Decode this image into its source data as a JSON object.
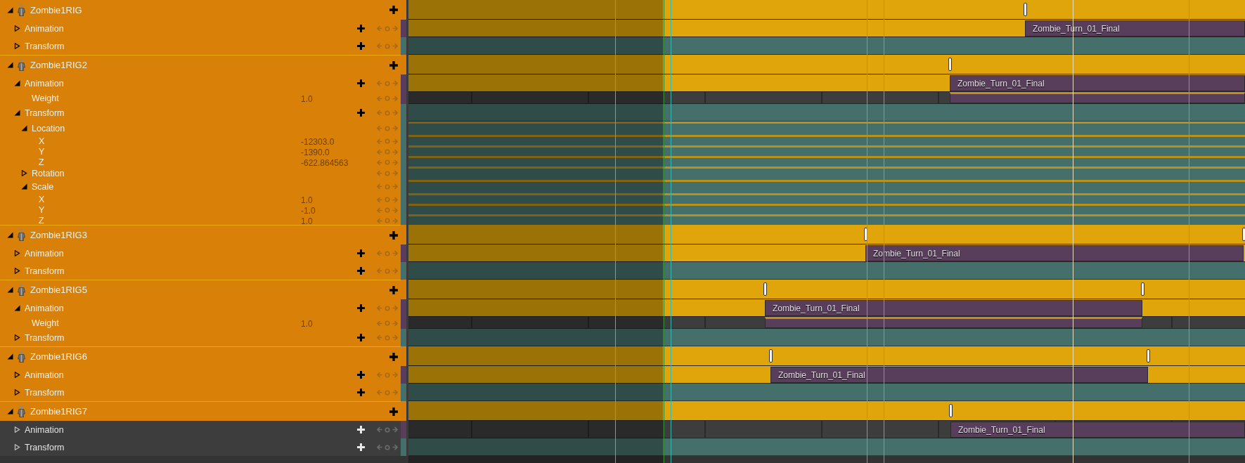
{
  "tracks": [
    {
      "kind": "actor",
      "label": "Zombie1RIG",
      "expanded": true,
      "selected": true,
      "children": [
        {
          "kind": "animation",
          "label": "Animation",
          "expanded": false,
          "selected": true,
          "section": {
            "label": "Zombie_Turn_01_Final"
          }
        },
        {
          "kind": "transform",
          "label": "Transform",
          "expanded": false,
          "selected": true
        }
      ]
    },
    {
      "kind": "actor",
      "label": "Zombie1RIG2",
      "expanded": true,
      "selected": true,
      "children": [
        {
          "kind": "animation",
          "label": "Animation",
          "expanded": true,
          "selected": true,
          "section": {
            "label": "Zombie_Turn_01_Final"
          },
          "children": [
            {
              "kind": "weight",
              "label": "Weight",
              "value": "1.0",
              "selected": true
            }
          ]
        },
        {
          "kind": "transform",
          "label": "Transform",
          "expanded": true,
          "selected": true,
          "children": [
            {
              "kind": "group",
              "label": "Location",
              "expanded": true,
              "selected": true,
              "children": [
                {
                  "kind": "channel",
                  "label": "X",
                  "value": "-12303.0",
                  "selected": true
                },
                {
                  "kind": "channel",
                  "label": "Y",
                  "value": "-1390.0",
                  "selected": true
                },
                {
                  "kind": "channel",
                  "label": "Z",
                  "value": "-622.864563",
                  "selected": true
                }
              ]
            },
            {
              "kind": "group",
              "label": "Rotation",
              "expanded": false,
              "selected": true
            },
            {
              "kind": "group",
              "label": "Scale",
              "expanded": true,
              "selected": true,
              "children": [
                {
                  "kind": "channel",
                  "label": "X",
                  "value": "1.0",
                  "selected": true
                },
                {
                  "kind": "channel",
                  "label": "Y",
                  "value": "-1.0",
                  "selected": true
                },
                {
                  "kind": "channel",
                  "label": "Z",
                  "value": "1.0",
                  "selected": true
                }
              ]
            }
          ]
        }
      ]
    },
    {
      "kind": "actor",
      "label": "Zombie1RIG3",
      "expanded": true,
      "selected": true,
      "children": [
        {
          "kind": "animation",
          "label": "Animation",
          "expanded": false,
          "selected": true,
          "section": {
            "label": "Zombie_Turn_01_Final"
          }
        },
        {
          "kind": "transform",
          "label": "Transform",
          "expanded": false,
          "selected": true
        }
      ]
    },
    {
      "kind": "actor",
      "label": "Zombie1RIG5",
      "expanded": true,
      "selected": true,
      "children": [
        {
          "kind": "animation",
          "label": "Animation",
          "expanded": true,
          "selected": true,
          "section": {
            "label": "Zombie_Turn_01_Final"
          },
          "children": [
            {
              "kind": "weight",
              "label": "Weight",
              "value": "1.0",
              "selected": true
            }
          ]
        },
        {
          "kind": "transform",
          "label": "Transform",
          "expanded": false,
          "selected": true
        }
      ]
    },
    {
      "kind": "actor",
      "label": "Zombie1RIG6",
      "expanded": true,
      "selected": true,
      "children": [
        {
          "kind": "animation",
          "label": "Animation",
          "expanded": false,
          "selected": true,
          "section": {
            "label": "Zombie_Turn_01_Final"
          }
        },
        {
          "kind": "transform",
          "label": "Transform",
          "expanded": false,
          "selected": true
        }
      ]
    },
    {
      "kind": "actor",
      "label": "Zombie1RIG7",
      "expanded": true,
      "selected": true,
      "children": [
        {
          "kind": "animation",
          "label": "Animation",
          "expanded": false,
          "selected": false,
          "section": {
            "label": "Zombie_Turn_01_Final"
          }
        },
        {
          "kind": "transform",
          "label": "Transform",
          "expanded": false,
          "selected": false
        }
      ]
    }
  ]
}
